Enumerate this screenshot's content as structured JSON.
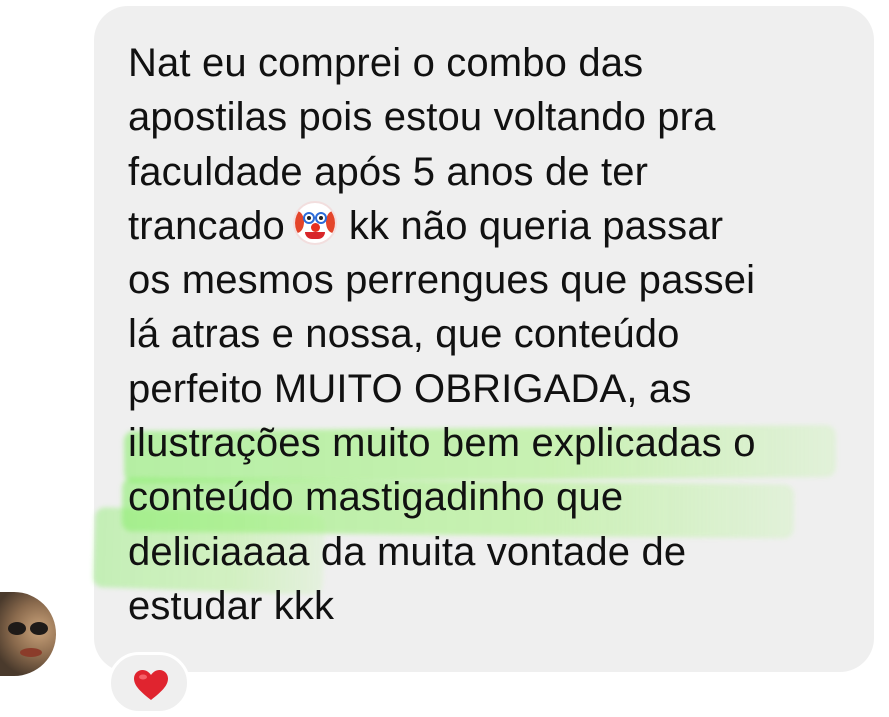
{
  "message": {
    "lines": [
      "Nat eu comprei o combo das",
      "apostilas pois estou voltando pra",
      "faculdade após 5 anos de ter",
      "trancado",
      "kk não queria passar",
      "os mesmos perrengues que passei",
      "lá atras e nossa, que conteúdo",
      "perfeito MUITO OBRIGADA, as",
      "ilustrações muito bem explicadas o",
      "conteúdo mastigadinho que",
      "deliciaaaa da muita vontade de",
      "estudar kkk"
    ],
    "inline_emoji": "clown-face-icon"
  },
  "reaction": {
    "emoji": "heart-icon",
    "color": "#e0242f"
  },
  "colors": {
    "bubble": "#efefef",
    "text": "#111111",
    "highlight": "#90ee74"
  }
}
